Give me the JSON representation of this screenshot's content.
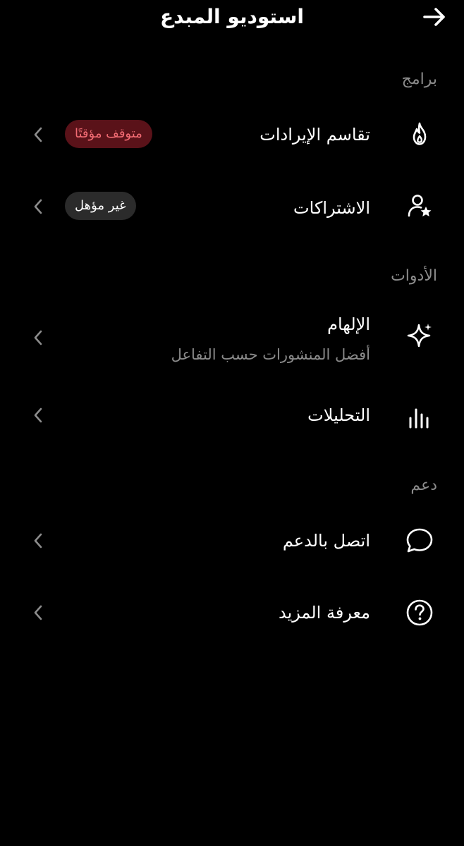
{
  "header": {
    "title": "استوديو المبدع",
    "back_icon": "arrow-right-icon"
  },
  "sections": [
    {
      "title": "برامج",
      "items": [
        {
          "label": "تقاسم الإيرادات",
          "icon": "flame-icon",
          "badge": "متوقف مؤقتًا",
          "badge_color": "#5a1219"
        },
        {
          "label": "الاشتراكات",
          "icon": "user-star-icon",
          "badge": "غير مؤهل",
          "badge_color": "#2b2b2b"
        }
      ]
    },
    {
      "title": "الأدوات",
      "items": [
        {
          "label": "الإلهام",
          "sublabel": "أفضل المنشورات حسب التفاعل",
          "icon": "sparkle-icon"
        },
        {
          "label": "التحليلات",
          "icon": "bar-chart-icon"
        }
      ]
    },
    {
      "title": "دعم",
      "items": [
        {
          "label": "اتصل بالدعم",
          "icon": "chat-bubble-icon"
        },
        {
          "label": "معرفة المزيد",
          "icon": "help-circle-icon"
        }
      ]
    }
  ]
}
